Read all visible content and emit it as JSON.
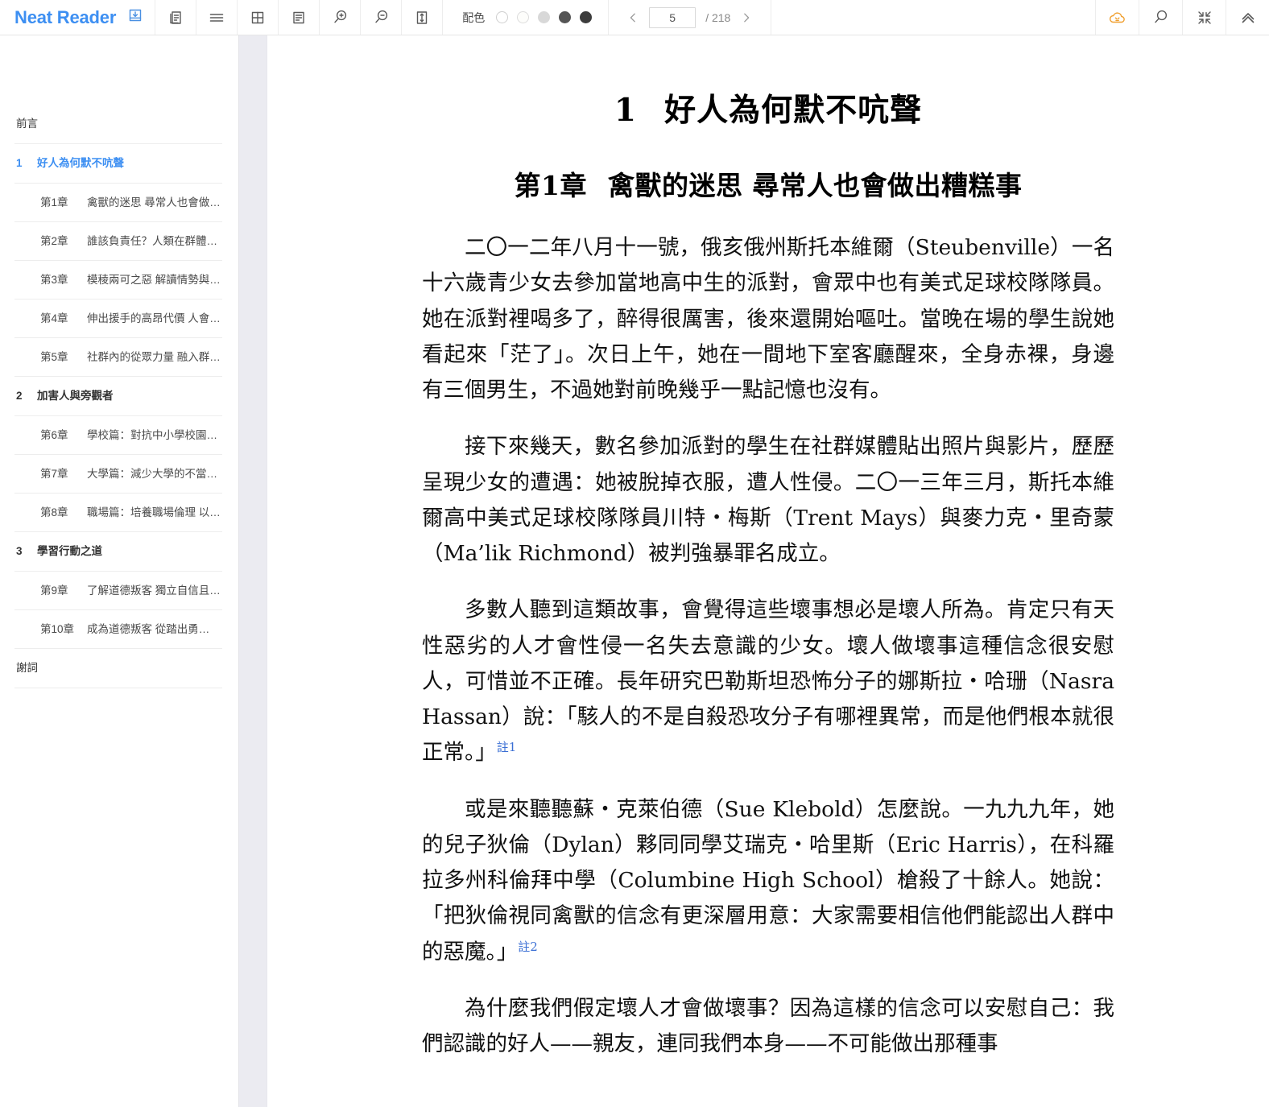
{
  "app": {
    "brand": "Neat Reader"
  },
  "toolbar": {
    "icons": [
      {
        "name": "save-to-library-icon",
        "label": "save-to-library"
      },
      {
        "name": "copy-page-icon",
        "label": "copy-page"
      },
      {
        "name": "single-column-view-icon",
        "label": "single-column-view"
      },
      {
        "name": "grid-view-icon",
        "label": "grid-view"
      },
      {
        "name": "paragraph-view-icon",
        "label": "paragraph-view"
      },
      {
        "name": "zoom-in-icon",
        "label": "zoom-in"
      },
      {
        "name": "zoom-out-icon",
        "label": "zoom-out"
      },
      {
        "name": "line-height-icon",
        "label": "line-height"
      }
    ],
    "scheme_label": "配色",
    "swatches": [
      {
        "name": "scheme-white",
        "color": "#ffffff",
        "border": "#cfcfcf",
        "selected": false
      },
      {
        "name": "scheme-paper",
        "color": "#fdfdfb",
        "border": "#d8d8d8",
        "selected": false
      },
      {
        "name": "scheme-light-gray",
        "color": "#d8d8d8",
        "border": "#d8d8d8",
        "selected": false
      },
      {
        "name": "scheme-dark-gray",
        "color": "#555555",
        "border": "#555555",
        "selected": false
      },
      {
        "name": "scheme-black",
        "color": "#3c3c3c",
        "border": "#3c3c3c",
        "selected": true
      }
    ],
    "pager": {
      "prev_label": "‹",
      "next_label": "›",
      "current_page": "5",
      "total_label": "/ 218"
    },
    "right_icons": [
      {
        "name": "cloud-sync-icon",
        "label": "cloud-sync",
        "color": "#f0a030"
      },
      {
        "name": "search-icon",
        "label": "search",
        "color": "#5a5a5a"
      },
      {
        "name": "collapse-icon",
        "label": "collapse-fullscreen",
        "color": "#5a5a5a"
      },
      {
        "name": "chevron-double-up-icon",
        "label": "hide-toolbar",
        "color": "#5a5a5a"
      }
    ]
  },
  "sidebar": {
    "items": [
      {
        "level": 0,
        "num": "",
        "text": "前言",
        "active": false
      },
      {
        "level": 1,
        "num": "1",
        "text": "好人為何默不吭聲",
        "active": true
      },
      {
        "level": 2,
        "num": "第1章",
        "text": "禽獸的迷思 尋常人也會做…",
        "active": false
      },
      {
        "level": 2,
        "num": "第2章",
        "text": "誰該負責任？人類在群體…",
        "active": false
      },
      {
        "level": 2,
        "num": "第3章",
        "text": "模稜兩可之惡 解讀情勢與…",
        "active": false
      },
      {
        "level": 2,
        "num": "第4章",
        "text": "伸出援手的高昂代價 人會…",
        "active": false
      },
      {
        "level": 2,
        "num": "第5章",
        "text": "社群內的從眾力量 融入群…",
        "active": false
      },
      {
        "level": 1,
        "num": "2",
        "text": "加害人與旁觀者",
        "active": false
      },
      {
        "level": 2,
        "num": "第6章",
        "text": "學校篇：對抗中小學校園…",
        "active": false
      },
      {
        "level": 2,
        "num": "第7章",
        "text": "大學篇：減少大學的不當…",
        "active": false
      },
      {
        "level": 2,
        "num": "第8章",
        "text": "職場篇：培養職場倫理 以…",
        "active": false
      },
      {
        "level": 1,
        "num": "3",
        "text": "學習行動之道",
        "active": false
      },
      {
        "level": 2,
        "num": "第9章",
        "text": "了解道德叛客 獨立自信且…",
        "active": false
      },
      {
        "level": 2,
        "num": "第10章",
        "text": "成為道德叛客 從踏出勇…",
        "active": false
      },
      {
        "level": 0,
        "num": "",
        "text": "謝詞",
        "active": false
      }
    ]
  },
  "reader": {
    "book_heading_num": "1",
    "book_heading_text": "好人為何默不吭聲",
    "chapter_heading_num": "第1章",
    "chapter_heading_text": "禽獸的迷思 尋常人也會做出糟糕事",
    "paragraphs": [
      {
        "id": "p1",
        "text": "二〇一二年八月十一號，俄亥俄州斯托本維爾（Steubenville）一名十六歲青少女去參加當地高中生的派對，會眾中也有美式足球校隊隊員。她在派對裡喝多了，醉得很厲害，後來還開始嘔吐。當晚在場的學生說她看起來「茫了」。次日上午，她在一間地下室客廳醒來，全身赤裸，身邊有三個男生，不過她對前晚幾乎一點記憶也沒有。",
        "footnote": ""
      },
      {
        "id": "p2",
        "text": "接下來幾天，數名參加派對的學生在社群媒體貼出照片與影片，歷歷呈現少女的遭遇：她被脫掉衣服，遭人性侵。二〇一三年三月，斯托本維爾高中美式足球校隊隊員川特・梅斯（Trent Mays）與麥力克・里奇蒙（Ma’lik Richmond）被判強暴罪名成立。",
        "footnote": ""
      },
      {
        "id": "p3",
        "text": "多數人聽到這類故事，會覺得這些壞事想必是壞人所為。肯定只有天性惡劣的人才會性侵一名失去意識的少女。壞人做壞事這種信念很安慰人，可惜並不正確。長年研究巴勒斯坦恐怖分子的娜斯拉・哈珊（Nasra Hassan）說：「駭人的不是自殺恐攻分子有哪裡異常，而是他們根本就很正常。」",
        "footnote": "註1"
      },
      {
        "id": "p4",
        "text": "或是來聽聽蘇・克萊伯德（Sue Klebold）怎麼說。一九九九年，她的兒子狄倫（Dylan）夥同同學艾瑞克・哈里斯（Eric Harris），在科羅拉多州科倫拜中學（Columbine High School）槍殺了十餘人。她說：「把狄倫視同禽獸的信念有更深層用意：大家需要相信他們能認出人群中的惡魔。」",
        "footnote": "註2"
      },
      {
        "id": "p5",
        "text": "為什麼我們假定壞人才會做壞事？因為這樣的信念可以安慰自己：我們認識的好人——親友，連同我們本身——不可能做出那種事",
        "footnote": ""
      }
    ]
  }
}
